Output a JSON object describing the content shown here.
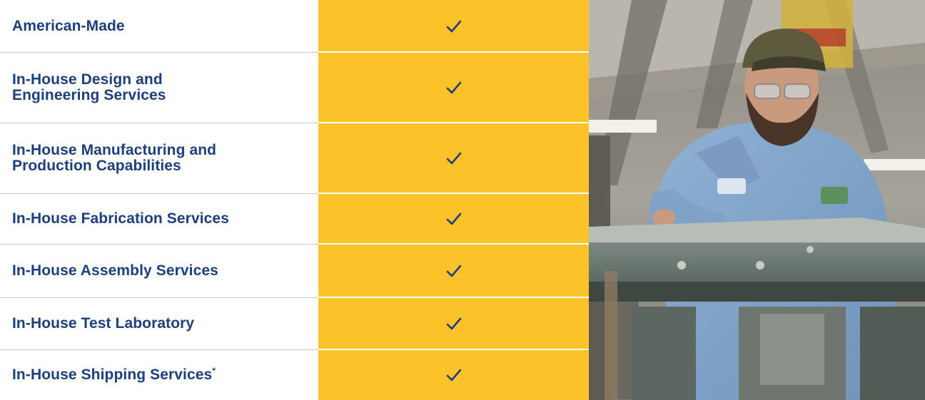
{
  "rows": [
    {
      "label": "American-Made",
      "has_asterisk": false,
      "checked": true
    },
    {
      "label": "In-House Design and Engineering Services",
      "has_asterisk": false,
      "checked": true
    },
    {
      "label": "In-House Manufacturing and Production Capabilities",
      "has_asterisk": false,
      "checked": true
    },
    {
      "label": "In-House Fabrication Services",
      "has_asterisk": false,
      "checked": true
    },
    {
      "label": "In-House Assembly Services",
      "has_asterisk": false,
      "checked": true
    },
    {
      "label": "In-House Test Laboratory",
      "has_asterisk": false,
      "checked": true
    },
    {
      "label": "In-House Shipping Services",
      "has_asterisk": true,
      "checked": true
    }
  ],
  "footnote_marker": "*",
  "icons": {
    "check": "checkmark-icon"
  },
  "colors": {
    "label_text": "#1d3f7c",
    "check_column": "#fcc22a",
    "check_mark": "#1d3f7c",
    "separator": "#c9c9c9"
  },
  "photo": {
    "subject": "factory-worker-photo"
  }
}
